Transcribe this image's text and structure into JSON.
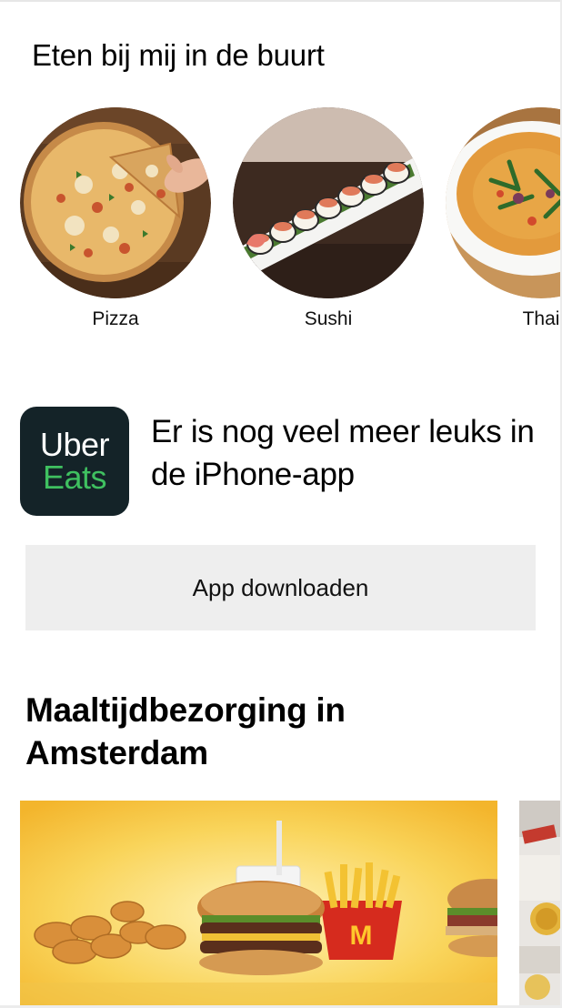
{
  "nearby": {
    "title": "Eten bij mij in de buurt",
    "categories": [
      {
        "label": "Pizza",
        "icon": "pizza-image"
      },
      {
        "label": "Sushi",
        "icon": "sushi-image"
      },
      {
        "label": "Thai",
        "icon": "thai-curry-image"
      }
    ]
  },
  "app_promo": {
    "logo_line1": "Uber",
    "logo_line2": "Eats",
    "text": "Er is nog veel meer leuks in de iPhone-app",
    "button_label": "App downloaden",
    "colors": {
      "logo_bg": "#142328",
      "logo_green": "#3fc060",
      "button_bg": "#eeeeee"
    }
  },
  "delivery": {
    "title": "Maaltijdbezorging in Amsterdam",
    "cards": [
      {
        "icon": "mcdonalds-meal-image"
      },
      {
        "icon": "restaurant-image"
      }
    ]
  }
}
